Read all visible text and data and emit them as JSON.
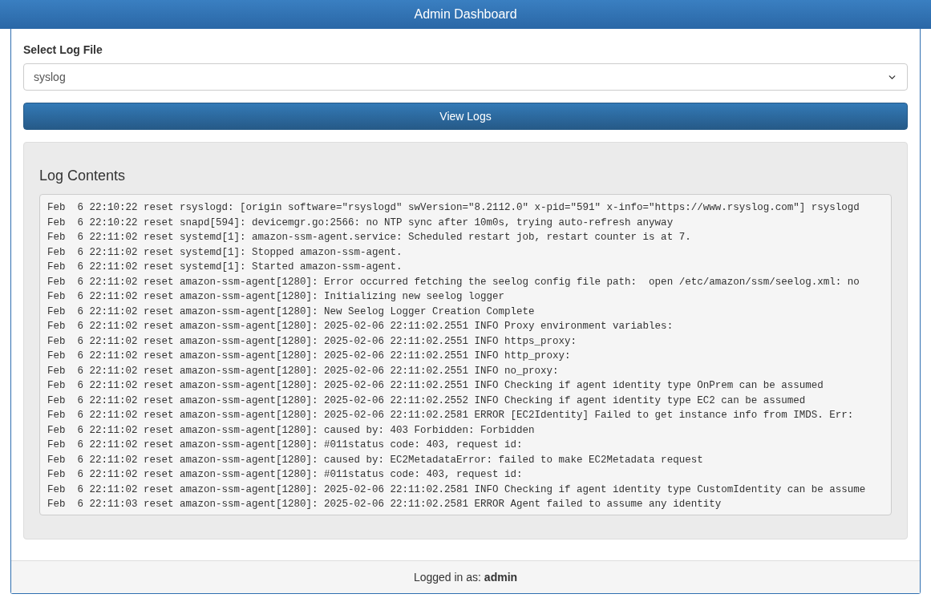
{
  "header": {
    "title": "Admin Dashboard"
  },
  "log_select": {
    "label": "Select Log File",
    "value": "syslog"
  },
  "view_button": {
    "label": "View Logs"
  },
  "log_panel": {
    "title": "Log Contents",
    "lines": [
      "Feb  6 22:10:22 reset rsyslogd: [origin software=\"rsyslogd\" swVersion=\"8.2112.0\" x-pid=\"591\" x-info=\"https://www.rsyslog.com\"] rsyslogd",
      "Feb  6 22:10:22 reset snapd[594]: devicemgr.go:2566: no NTP sync after 10m0s, trying auto-refresh anyway",
      "Feb  6 22:11:02 reset systemd[1]: amazon-ssm-agent.service: Scheduled restart job, restart counter is at 7.",
      "Feb  6 22:11:02 reset systemd[1]: Stopped amazon-ssm-agent.",
      "Feb  6 22:11:02 reset systemd[1]: Started amazon-ssm-agent.",
      "Feb  6 22:11:02 reset amazon-ssm-agent[1280]: Error occurred fetching the seelog config file path:  open /etc/amazon/ssm/seelog.xml: no",
      "Feb  6 22:11:02 reset amazon-ssm-agent[1280]: Initializing new seelog logger",
      "Feb  6 22:11:02 reset amazon-ssm-agent[1280]: New Seelog Logger Creation Complete",
      "Feb  6 22:11:02 reset amazon-ssm-agent[1280]: 2025-02-06 22:11:02.2551 INFO Proxy environment variables:",
      "Feb  6 22:11:02 reset amazon-ssm-agent[1280]: 2025-02-06 22:11:02.2551 INFO https_proxy:",
      "Feb  6 22:11:02 reset amazon-ssm-agent[1280]: 2025-02-06 22:11:02.2551 INFO http_proxy:",
      "Feb  6 22:11:02 reset amazon-ssm-agent[1280]: 2025-02-06 22:11:02.2551 INFO no_proxy:",
      "Feb  6 22:11:02 reset amazon-ssm-agent[1280]: 2025-02-06 22:11:02.2551 INFO Checking if agent identity type OnPrem can be assumed",
      "Feb  6 22:11:02 reset amazon-ssm-agent[1280]: 2025-02-06 22:11:02.2552 INFO Checking if agent identity type EC2 can be assumed",
      "Feb  6 22:11:02 reset amazon-ssm-agent[1280]: 2025-02-06 22:11:02.2581 ERROR [EC2Identity] Failed to get instance info from IMDS. Err:",
      "Feb  6 22:11:02 reset amazon-ssm-agent[1280]: caused by: 403 Forbidden: Forbidden",
      "Feb  6 22:11:02 reset amazon-ssm-agent[1280]: #011status code: 403, request id:",
      "Feb  6 22:11:02 reset amazon-ssm-agent[1280]: caused by: EC2MetadataError: failed to make EC2Metadata request",
      "Feb  6 22:11:02 reset amazon-ssm-agent[1280]: #011status code: 403, request id:",
      "Feb  6 22:11:02 reset amazon-ssm-agent[1280]: 2025-02-06 22:11:02.2581 INFO Checking if agent identity type CustomIdentity can be assume",
      "Feb  6 22:11:03 reset amazon-ssm-agent[1280]: 2025-02-06 22:11:02.2581 ERROR Agent failed to assume any identity"
    ]
  },
  "footer": {
    "text": "Logged in as: **admin**"
  }
}
